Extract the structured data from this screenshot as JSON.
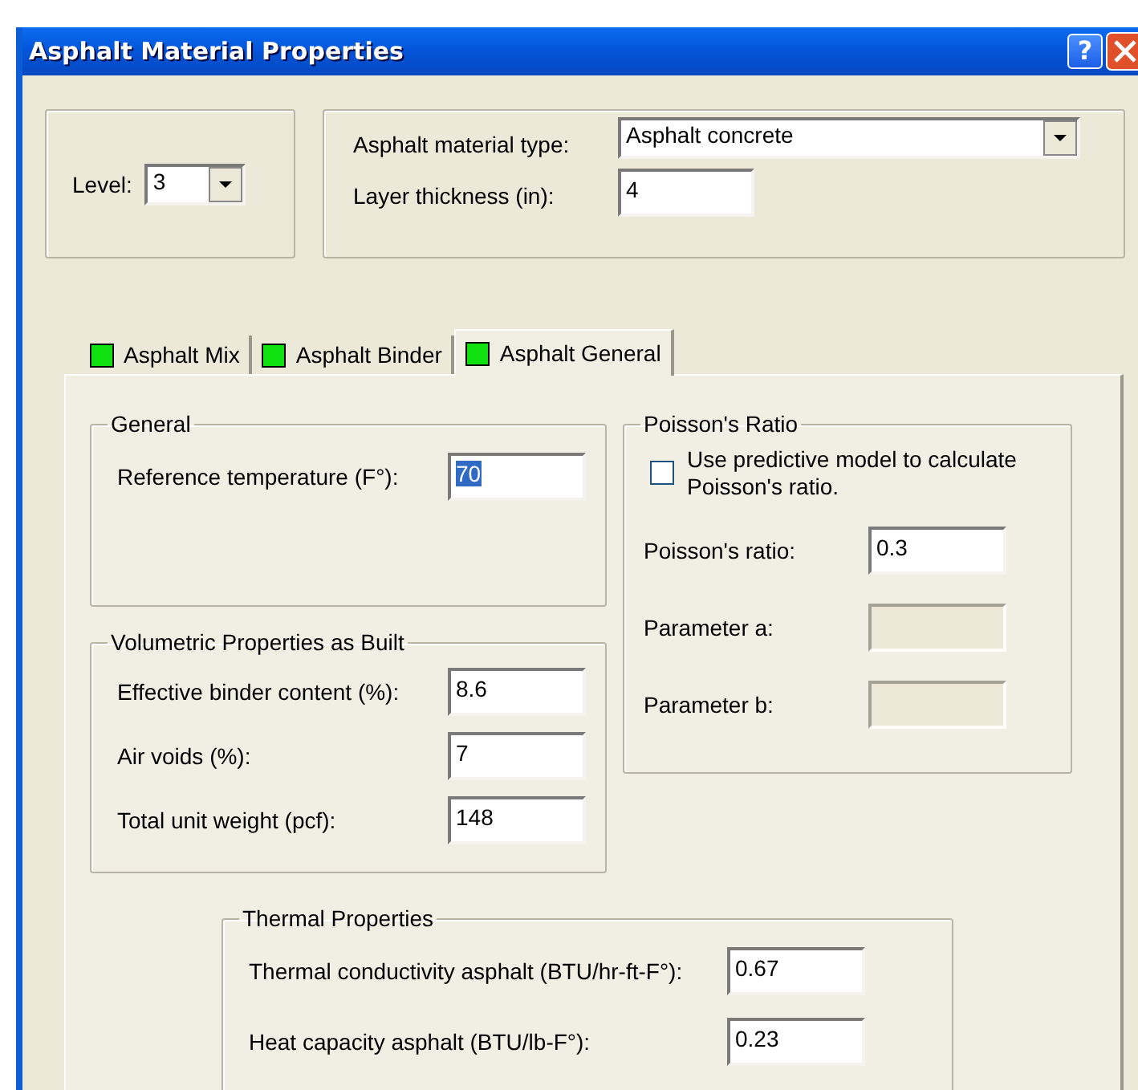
{
  "window": {
    "title": "Asphalt Material Properties",
    "help_button": "?"
  },
  "level": {
    "label": "Level:",
    "value": "3"
  },
  "material": {
    "type_label": "Asphalt material type:",
    "type_value": "Asphalt concrete",
    "thickness_label": "Layer thickness (in):",
    "thickness_value": "4"
  },
  "tabs": [
    {
      "label": "Asphalt Mix",
      "selected": false
    },
    {
      "label": "Asphalt Binder",
      "selected": false
    },
    {
      "label": "Asphalt General",
      "selected": true
    }
  ],
  "general": {
    "title": "General",
    "fields": [
      {
        "label": "Reference temperature (F°):",
        "value": "70",
        "selected": true
      }
    ]
  },
  "poisson": {
    "title": "Poisson's Ratio",
    "checkbox": {
      "label": "Use predictive model to calculate Poisson's ratio.",
      "checked": false
    },
    "fields": [
      {
        "label": "Poisson's ratio:",
        "value": "0.3",
        "disabled": false
      },
      {
        "label": "Parameter a:",
        "disabled": true
      },
      {
        "label": "Parameter b:",
        "disabled": true
      }
    ]
  },
  "volumetric": {
    "title": "Volumetric Properties as Built",
    "fields": [
      {
        "label": "Effective binder content (%):",
        "value": "8.6"
      },
      {
        "label": "Air voids (%):",
        "value": "7"
      },
      {
        "label": "Total unit weight (pcf):",
        "value": "148"
      }
    ]
  },
  "thermal": {
    "title": "Thermal Properties",
    "fields": [
      {
        "label": "Thermal conductivity asphalt (BTU/hr-ft-F°):",
        "value": "0.67"
      },
      {
        "label": "Heat capacity asphalt (BTU/lb-F°):",
        "value": "0.23"
      }
    ]
  }
}
